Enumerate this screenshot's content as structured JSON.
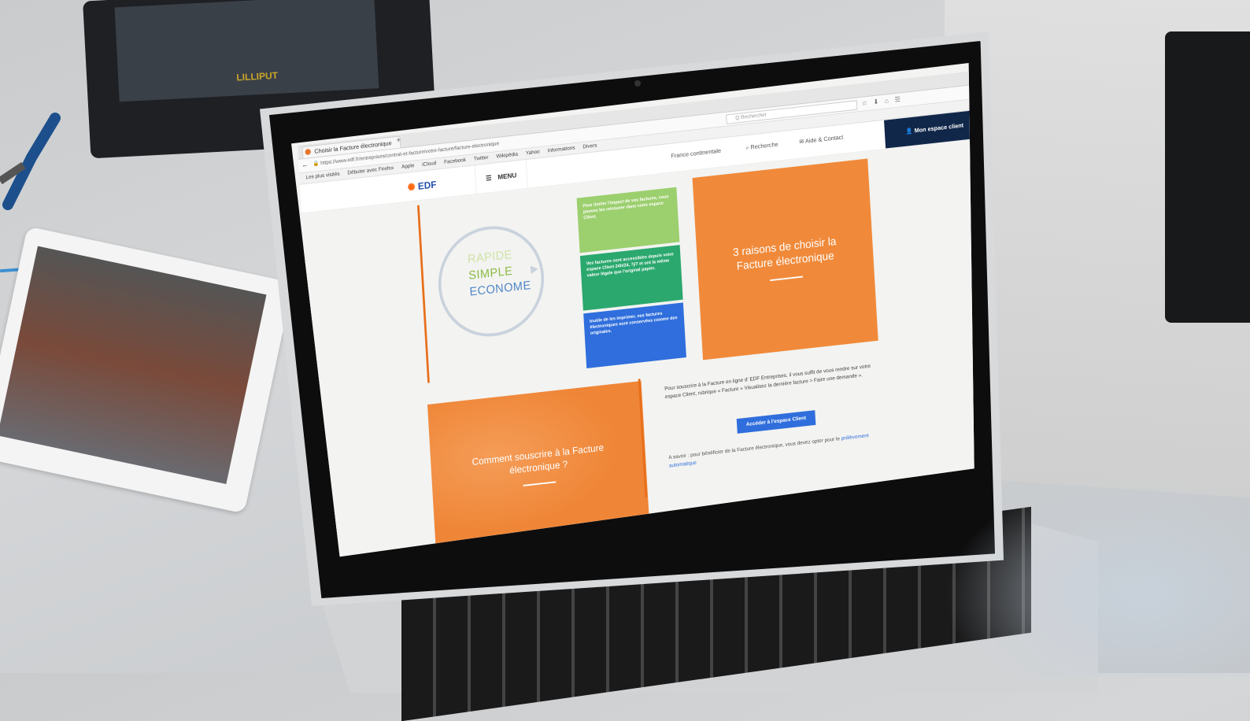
{
  "background": {
    "monitor_brand": "LILLIPUT"
  },
  "browser": {
    "tab_title": "Choisir la Facture électronique",
    "url": "https://www.edf.fr/entreprises/contrat-et-facture/votre-facture/facture-electronique",
    "search_placeholder": "Q Rechercher",
    "bookmarks": [
      "Les plus visités",
      "Débuter avec Firefox",
      "Apple",
      "iCloud",
      "Facebook",
      "Twitter",
      "Wikipédia",
      "Yahoo",
      "Informations",
      "Divers"
    ]
  },
  "site": {
    "logo_text": "EDF",
    "menu_label": "MENU",
    "region_label": "France continentale",
    "recherche_label": "Recherche",
    "aide_label": "Aide & Contact",
    "espace_client_label": "Mon espace client"
  },
  "hero": {
    "words": [
      "RAPIDE",
      "SIMPLE",
      "ECONOME"
    ],
    "cards": [
      "Pour limiter l'impact de vos factures, vous pouvez les retrouver dans votre espace Client.",
      "Vos factures sont accessibles depuis votre espace Client 24h/24, 7j/7 et ont la même valeur légale que l'original papier.",
      "Inutile de les imprimer, vos factures électroniques sont conservées comme des originales."
    ],
    "big_title": "3 raisons de choisir la Facture électronique"
  },
  "subscribe": {
    "title": "Comment souscrire à la Facture électronique ?",
    "text": "Pour souscrire à la Facture en ligne d' EDF Entreprises, il vous suffit de vous rendre sur votre espace Client, rubrique « Facture » Visualisez la dernière facture > Faire une demande ».",
    "cta_label": "Accéder à l'espace Client",
    "savoir_prefix": "A savoir : pour bénéficier de la Facture électronique, vous devez opter pour le",
    "savoir_link": "prélèvement automatique"
  },
  "colors": {
    "edf_orange": "#f08a3a",
    "edf_blue": "#2f6edc",
    "edf_navy": "#10274a",
    "green_light": "#9ccf6e",
    "green_dark": "#2ba86e"
  }
}
